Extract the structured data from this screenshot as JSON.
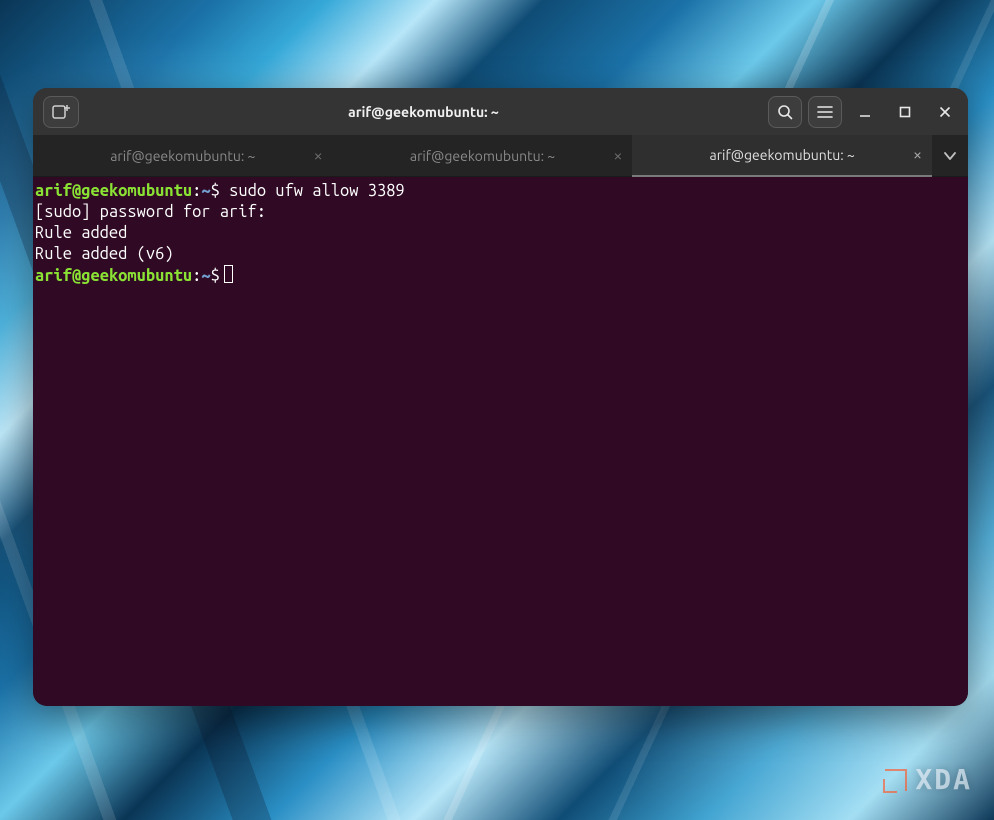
{
  "watermark": {
    "text": "XDA"
  },
  "window": {
    "title": "arif@geekomubuntu: ~"
  },
  "tabs": [
    {
      "label": "arif@geekomubuntu: ~",
      "active": false
    },
    {
      "label": "arif@geekomubuntu: ~",
      "active": false
    },
    {
      "label": "arif@geekomubuntu: ~",
      "active": true
    }
  ],
  "prompt": {
    "user": "arif",
    "host": "geekomubuntu",
    "path": "~",
    "symbol": "$"
  },
  "terminal": {
    "line1_command": "sudo ufw allow 3389",
    "line2": "[sudo] password for arif:",
    "line3": "Rule added",
    "line4": "Rule added (v6)"
  },
  "colors": {
    "terminal_bg": "#300a24",
    "prompt_user": "#8ae234",
    "prompt_path": "#729fcf",
    "header_bg": "#343434"
  }
}
